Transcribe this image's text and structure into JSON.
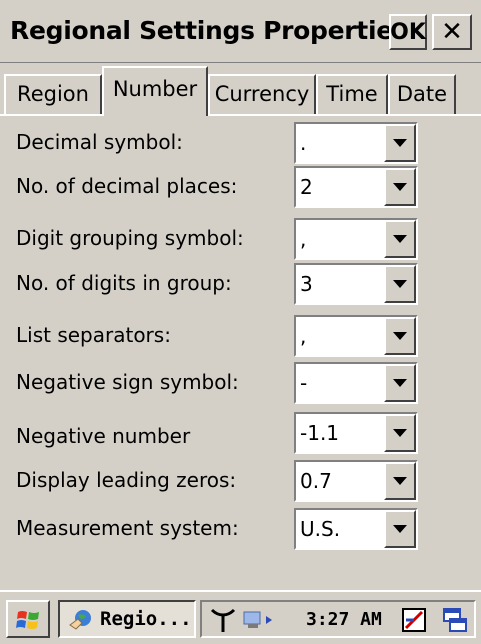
{
  "window": {
    "title": "Regional Settings Properties",
    "ok_label": "OK",
    "close_label": "✕"
  },
  "tabs": [
    {
      "label": "Region",
      "active": false
    },
    {
      "label": "Number",
      "active": true
    },
    {
      "label": "Currency",
      "active": false
    },
    {
      "label": "Time",
      "active": false
    },
    {
      "label": "Date",
      "active": false
    }
  ],
  "settings": [
    {
      "label": "Decimal symbol:",
      "value": "."
    },
    {
      "label": "No. of decimal places:",
      "value": "2"
    },
    {
      "label": "Digit grouping symbol:",
      "value": ","
    },
    {
      "label": "No. of digits in group:",
      "value": "3"
    },
    {
      "label": "List separators:",
      "value": ","
    },
    {
      "label": "Negative sign symbol:",
      "value": "-"
    },
    {
      "label": "Negative number",
      "value": "-1.1"
    },
    {
      "label": "Display leading zeros:",
      "value": "0.7"
    },
    {
      "label": "Measurement system:",
      "value": "U.S."
    }
  ],
  "taskbar": {
    "task_label": "Regio...",
    "clock": "3:27 AM"
  }
}
